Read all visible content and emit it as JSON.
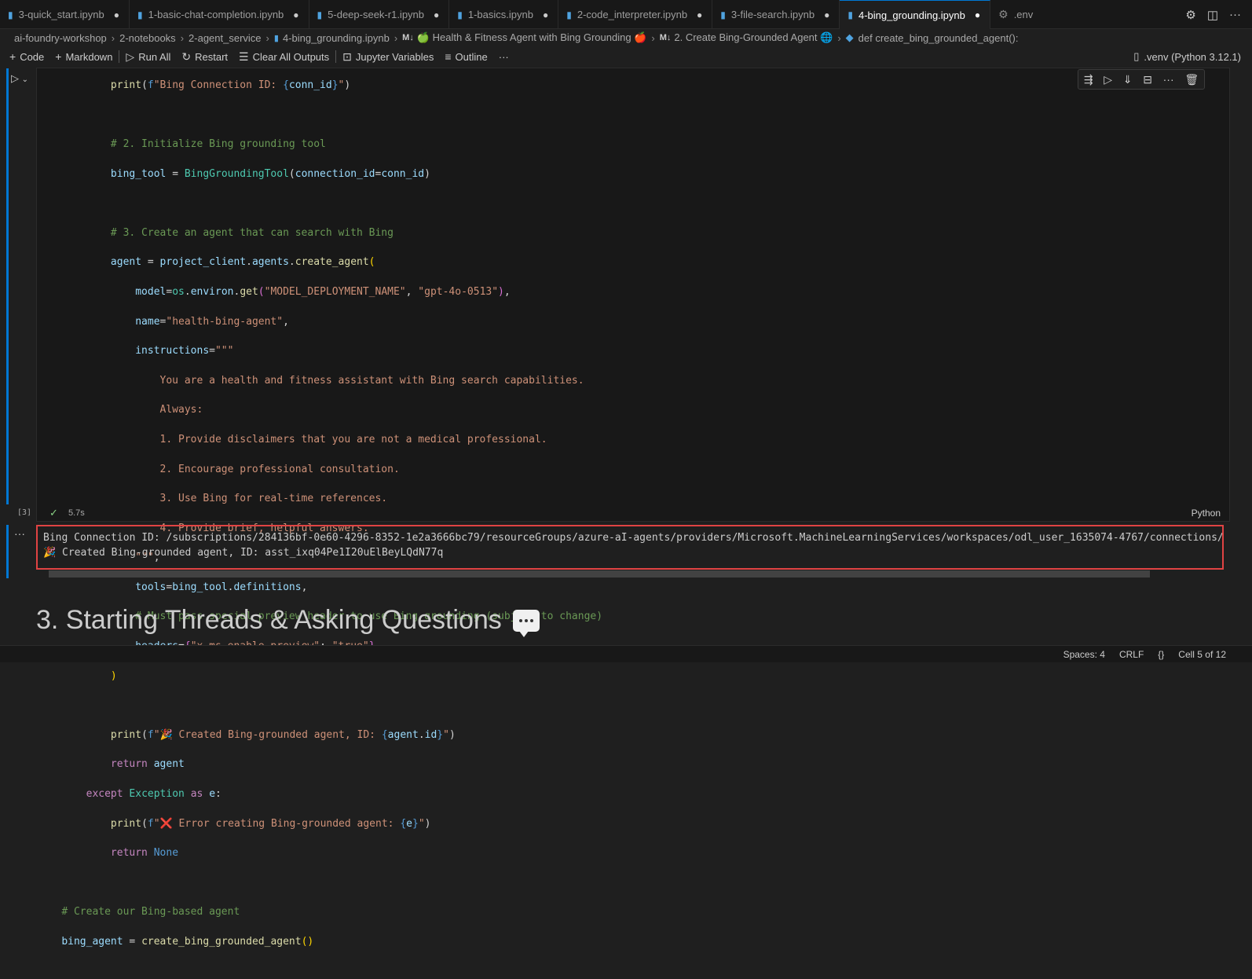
{
  "tabs": [
    {
      "label": "3-quick_start.ipynb",
      "modified": true,
      "icon": "notebook-icon"
    },
    {
      "label": "1-basic-chat-completion.ipynb",
      "modified": true,
      "icon": "notebook-icon"
    },
    {
      "label": "5-deep-seek-r1.ipynb",
      "modified": true,
      "icon": "notebook-icon"
    },
    {
      "label": "1-basics.ipynb",
      "modified": true,
      "icon": "notebook-icon"
    },
    {
      "label": "2-code_interpreter.ipynb",
      "modified": true,
      "icon": "notebook-icon"
    },
    {
      "label": "3-file-search.ipynb",
      "modified": true,
      "icon": "notebook-icon"
    },
    {
      "label": "4-bing_grounding.ipynb",
      "modified": true,
      "active": true,
      "icon": "notebook-icon"
    },
    {
      "label": ".env",
      "modified": false,
      "icon": "gear-icon"
    }
  ],
  "tab_dot": "●",
  "breadcrumb": {
    "items": [
      "ai-foundry-workshop",
      "2-notebooks",
      "2-agent_service",
      "4-bing_grounding.ipynb"
    ],
    "md_label": "M↓",
    "section1": "🍏 Health & Fitness Agent with Bing Grounding 🍎",
    "section2": "2. Create Bing-Grounded Agent 🌐",
    "func": "def create_bing_grounded_agent():"
  },
  "toolbar": {
    "code": "Code",
    "markdown": "Markdown",
    "run_all": "Run All",
    "restart": "Restart",
    "clear_outputs": "Clear All Outputs",
    "jupyter_variables": "Jupyter Variables",
    "outline": "Outline",
    "more": "···",
    "kernel": ".venv (Python 3.12.1)"
  },
  "cell": {
    "exec_count": "[3]",
    "exec_time": "5.7s",
    "language": "Python"
  },
  "output": {
    "lines": [
      "Bing Connection ID: /subscriptions/284136bf-0e60-4296-8352-1e2a3666bc79/resourceGroups/azure-aI-agents/providers/Microsoft.MachineLearningServices/workspaces/odl_user_1635074-4767/connections/",
      "🎉 Created Bing-grounded agent, ID: asst_ixq04Pe1I20uElBeyLQdN77q"
    ]
  },
  "heading": "3. Starting Threads & Asking Questions",
  "statusbar": {
    "spaces": "Spaces: 4",
    "eol": "CRLF",
    "braces": "{}",
    "cell": "Cell 5 of 12"
  }
}
